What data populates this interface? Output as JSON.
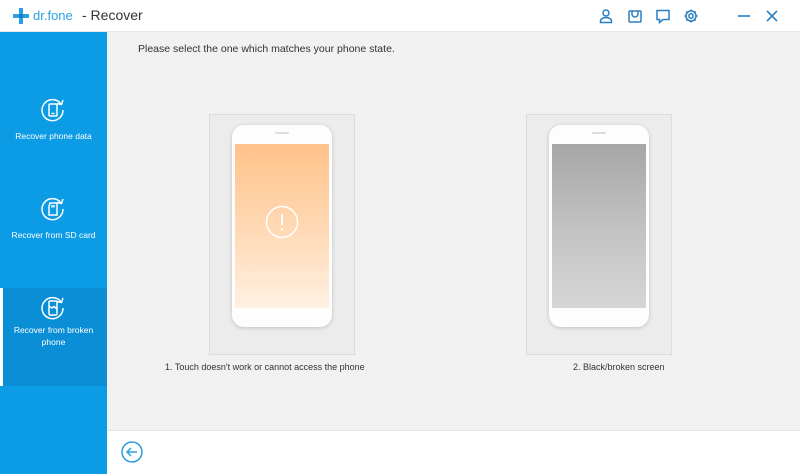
{
  "titlebar": {
    "brand": "dr.fone",
    "title": "- Recover",
    "icons": [
      "user-icon",
      "store-icon",
      "feedback-icon",
      "settings-icon"
    ],
    "window_controls": [
      "minimize-icon",
      "close-icon"
    ]
  },
  "sidebar": {
    "items": [
      {
        "label": "Recover phone data",
        "icon": "phone-recover-icon",
        "active": false
      },
      {
        "label": "Recover from SD card",
        "icon": "sd-card-recover-icon",
        "active": false
      },
      {
        "label": "Recover from broken phone",
        "icon": "broken-phone-recover-icon",
        "active": true
      }
    ]
  },
  "main": {
    "prompt": "Please select the one which matches your phone state.",
    "options": [
      {
        "label": "1. Touch doesn't work or cannot access the phone",
        "screen": "orange",
        "icon": "warning-icon"
      },
      {
        "label": "2. Black/broken screen",
        "screen": "gray"
      }
    ]
  },
  "footer": {
    "back_icon": "back-arrow-icon"
  },
  "colors": {
    "accent": "#0c9be5",
    "brand_blue": "#2aa0e0",
    "main_bg": "#f1f1f1",
    "screen_orange": "#ffc28a",
    "screen_gray": "#a6a6a6"
  }
}
